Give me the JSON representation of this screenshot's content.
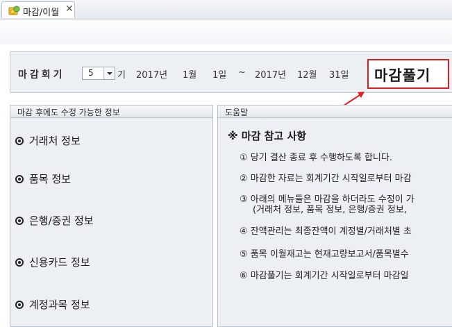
{
  "tab": {
    "label": "마감/이월",
    "close_glyph": "✕"
  },
  "period": {
    "label": "마감회기",
    "selected": "5",
    "suffix": "기",
    "start_year": "2017년",
    "start_month": "1월",
    "start_day": "1일",
    "separator": "~",
    "end_year": "2017년",
    "end_month": "12월",
    "end_day": "31일"
  },
  "close_button": {
    "label": "마감풀기"
  },
  "left_panel": {
    "header": "마감 후에도 수정 가능한 정보",
    "items": [
      "거래처 정보",
      "품목 정보",
      "은행/증권 정보",
      "신용카드 정보",
      "계정과목 정보"
    ]
  },
  "right_panel": {
    "header": "도움말",
    "title": "※ 마감 참고 사항",
    "lines": [
      "① 당기 결산 종료 후 수행하도록 합니다.",
      "② 마감한 자료는 회계기간 시작일로부터 마감",
      "③ 아래의 메뉴들은 마감을 하더라도 수정이 가",
      "(거래처 정보, 품목 정보, 은행/증권 정보,",
      "④ 잔액관리는 최종잔액이 계정별/거래처별 초",
      "⑤ 품목 이월재고는 현재고량보고서/품목별수",
      "⑥ 마감풀기는 회계기간 시작일로부터 마감일"
    ]
  },
  "colors": {
    "accent_red": "#e02020",
    "panel_bg": "#eceff3"
  }
}
